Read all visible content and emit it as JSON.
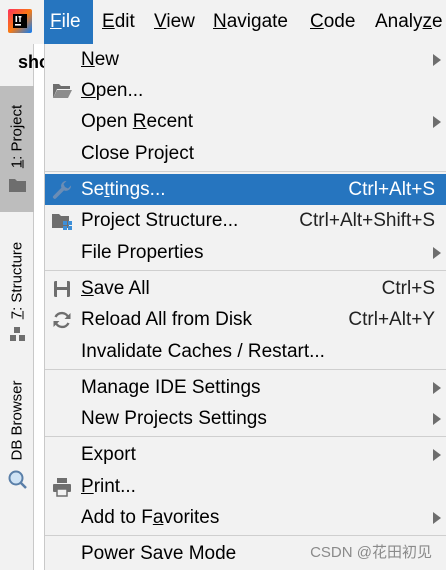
{
  "menubar": {
    "logo_icon": "intellij-logo-icon",
    "items": [
      {
        "pre": "",
        "mn": "F",
        "post": "ile"
      },
      {
        "pre": "",
        "mn": "E",
        "post": "dit"
      },
      {
        "pre": "",
        "mn": "V",
        "post": "iew"
      },
      {
        "pre": "",
        "mn": "N",
        "post": "avigate"
      },
      {
        "pre": "",
        "mn": "C",
        "post": "ode"
      },
      {
        "pre": "Analy",
        "mn": "z",
        "post": "e"
      }
    ]
  },
  "editor_tab": {
    "text": "sho"
  },
  "tool_strip": {
    "project": {
      "pre": "",
      "mn": "1",
      "post": ": Project"
    },
    "structure": {
      "pre": "",
      "mn": "7",
      "post": ": Structure"
    },
    "db_browser": {
      "text": "DB Browser"
    }
  },
  "file_menu": {
    "items": [
      {
        "pre": "",
        "mn": "N",
        "post": "ew",
        "shortcut": "",
        "submenu": true,
        "icon": ""
      },
      {
        "pre": "",
        "mn": "O",
        "post": "pen...",
        "shortcut": "",
        "submenu": false,
        "icon": "folder-open-icon"
      },
      {
        "pre": "Open ",
        "mn": "R",
        "post": "ecent",
        "shortcut": "",
        "submenu": true,
        "icon": ""
      },
      {
        "pre": "Close Project",
        "mn": "",
        "post": "",
        "shortcut": "",
        "submenu": false,
        "icon": ""
      },
      {
        "pre": "Se",
        "mn": "t",
        "post": "tings...",
        "shortcut": "Ctrl+Alt+S",
        "submenu": false,
        "icon": "wrench-icon",
        "selected": true
      },
      {
        "pre": "Project Structure...",
        "mn": "",
        "post": "",
        "shortcut": "Ctrl+Alt+Shift+S",
        "submenu": false,
        "icon": "project-structure-icon"
      },
      {
        "pre": "File Properties",
        "mn": "",
        "post": "",
        "shortcut": "",
        "submenu": true,
        "icon": ""
      },
      {
        "pre": "",
        "mn": "S",
        "post": "ave All",
        "shortcut": "Ctrl+S",
        "submenu": false,
        "icon": "save-icon"
      },
      {
        "pre": "Reload All from Disk",
        "mn": "",
        "post": "",
        "shortcut": "Ctrl+Alt+Y",
        "submenu": false,
        "icon": "reload-icon"
      },
      {
        "pre": "Invalidate Caches / Restart...",
        "mn": "",
        "post": "",
        "shortcut": "",
        "submenu": false,
        "icon": ""
      },
      {
        "pre": "Manage IDE Settings",
        "mn": "",
        "post": "",
        "shortcut": "",
        "submenu": true,
        "icon": ""
      },
      {
        "pre": "New Projects Settings",
        "mn": "",
        "post": "",
        "shortcut": "",
        "submenu": true,
        "icon": ""
      },
      {
        "pre": "Export",
        "mn": "",
        "post": "",
        "shortcut": "",
        "submenu": true,
        "icon": ""
      },
      {
        "pre": "",
        "mn": "P",
        "post": "rint...",
        "shortcut": "",
        "submenu": false,
        "icon": "print-icon"
      },
      {
        "pre": "Add to F",
        "mn": "a",
        "post": "vorites",
        "shortcut": "",
        "submenu": true,
        "icon": ""
      },
      {
        "pre": "Power Save Mode",
        "mn": "",
        "post": "",
        "shortcut": "",
        "submenu": false,
        "icon": ""
      }
    ]
  },
  "watermark": "CSDN @花田初见",
  "colors": {
    "accent": "#2675bf",
    "menu_bg": "#f2f2f2"
  }
}
